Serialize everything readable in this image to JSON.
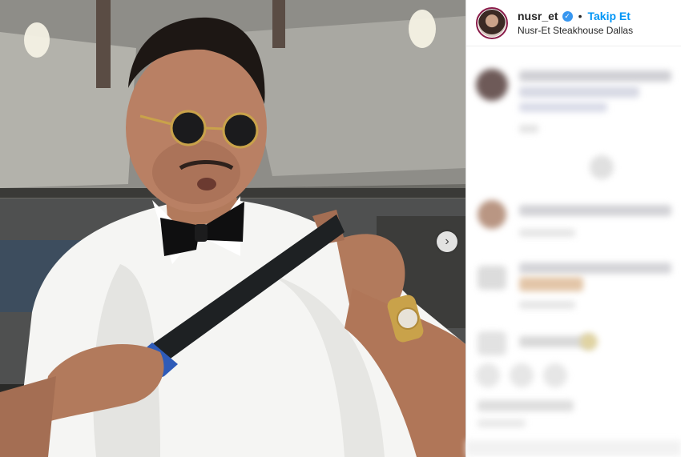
{
  "post": {
    "username": "nusr_et",
    "verified_mark": "✓",
    "separator": "•",
    "follow_label": "Takip Et",
    "location": "Nusr-Et Steakhouse Dallas"
  },
  "carousel": {
    "next_arrow": "›"
  },
  "icons": {
    "verified": "verified-badge-icon",
    "next": "chevron-right-icon"
  },
  "colors": {
    "accent": "#0095f6",
    "verified": "#3897f0"
  }
}
